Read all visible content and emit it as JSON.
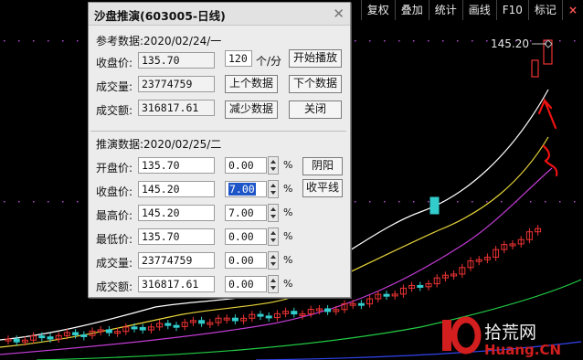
{
  "toolbar": {
    "items": [
      "复权",
      "叠加",
      "统计",
      "画线",
      "F10",
      "标记"
    ],
    "close_label": "×"
  },
  "chart": {
    "top_price_label": "145.20"
  },
  "dialog": {
    "title": "沙盘推演(603005-日线)",
    "ref_header": "参考数据:2020/02/24/一",
    "ref_rows": [
      {
        "label": "收盘价:",
        "value": "135.70"
      },
      {
        "label": "成交量:",
        "value": "23774759"
      },
      {
        "label": "成交额:",
        "value": "316817.61"
      }
    ],
    "speed_value": "120",
    "speed_unit": "个/分",
    "buttons": {
      "start": "开始播放",
      "prev": "上个数据",
      "next": "下个数据",
      "reduce": "减少数据",
      "close": "关闭",
      "yin_yang": "阴阳",
      "flat": "收平线"
    },
    "sim_header": "推演数据:2020/02/25/二",
    "sim_rows": [
      {
        "label": "开盘价:",
        "value": "135.70",
        "pct": "0.00"
      },
      {
        "label": "收盘价:",
        "value": "145.20",
        "pct": "7.00"
      },
      {
        "label": "最高价:",
        "value": "145.20",
        "pct": "7.00"
      },
      {
        "label": "最低价:",
        "value": "135.70",
        "pct": "0.00"
      },
      {
        "label": "成交量:",
        "value": "23774759",
        "pct": "0.00"
      },
      {
        "label": "成交额:",
        "value": "316817.61",
        "pct": "0.00"
      }
    ],
    "pct_symbol": "%"
  },
  "watermark": {
    "text": "拾荒网",
    "sub": "Huang.CN"
  }
}
